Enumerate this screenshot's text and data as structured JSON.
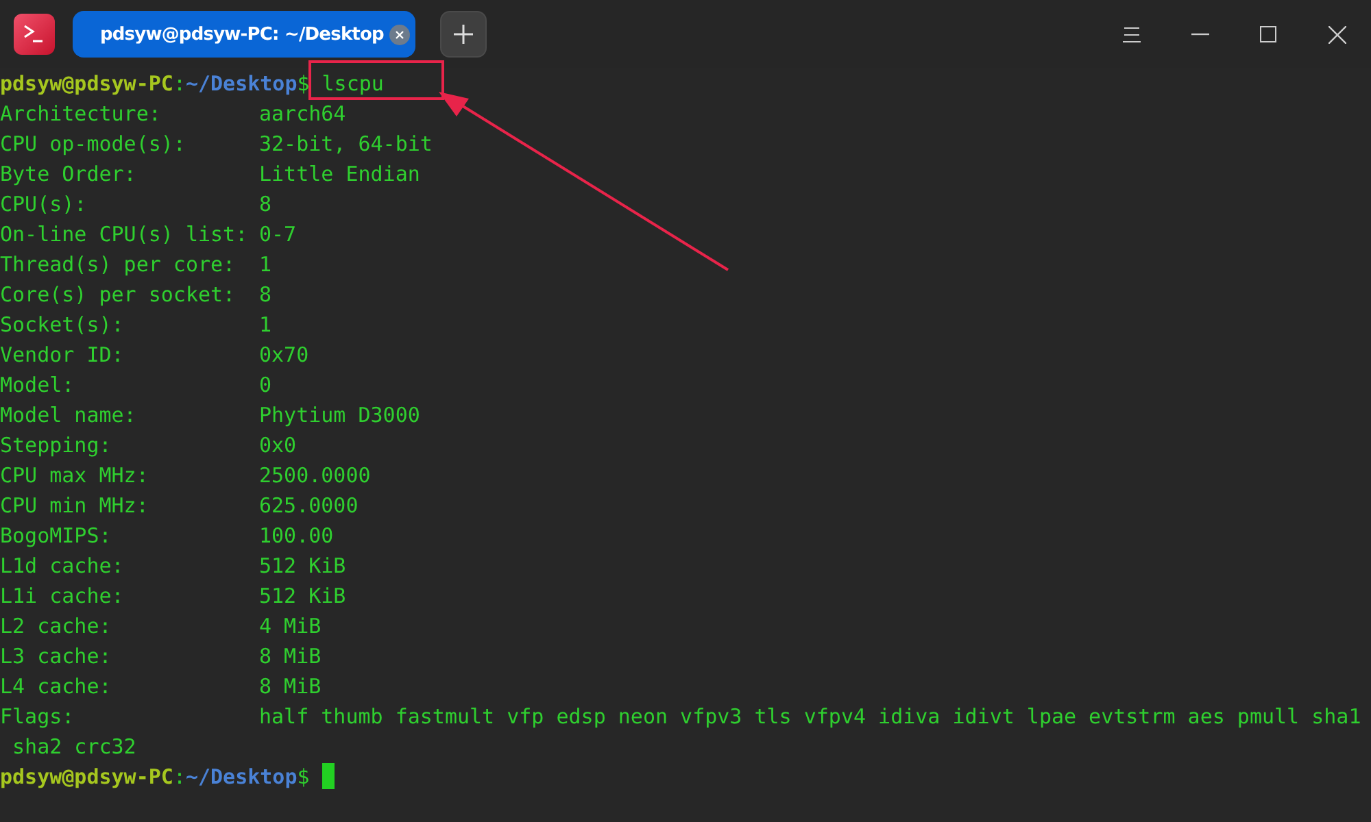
{
  "window": {
    "tab_title": "pdsyw@pdsyw-PC: ~/Desktop"
  },
  "terminal": {
    "lines": [
      {
        "kind": "prompt",
        "user": "pdsyw@pdsyw-PC",
        "sep": ":",
        "path": "~/Desktop",
        "sign": "$",
        "command": "lscpu"
      },
      {
        "kind": "field",
        "key": "Architecture:",
        "value": "aarch64"
      },
      {
        "kind": "field",
        "key": "CPU op-mode(s):",
        "value": "32-bit, 64-bit"
      },
      {
        "kind": "field",
        "key": "Byte Order:",
        "value": "Little Endian"
      },
      {
        "kind": "field",
        "key": "CPU(s):",
        "value": "8"
      },
      {
        "kind": "field",
        "key": "On-line CPU(s) list:",
        "value": "0-7"
      },
      {
        "kind": "field",
        "key": "Thread(s) per core:",
        "value": "1"
      },
      {
        "kind": "field",
        "key": "Core(s) per socket:",
        "value": "8"
      },
      {
        "kind": "field",
        "key": "Socket(s):",
        "value": "1"
      },
      {
        "kind": "field",
        "key": "Vendor ID:",
        "value": "0x70"
      },
      {
        "kind": "field",
        "key": "Model:",
        "value": "0"
      },
      {
        "kind": "field",
        "key": "Model name:",
        "value": "Phytium D3000"
      },
      {
        "kind": "field",
        "key": "Stepping:",
        "value": "0x0"
      },
      {
        "kind": "field",
        "key": "CPU max MHz:",
        "value": "2500.0000"
      },
      {
        "kind": "field",
        "key": "CPU min MHz:",
        "value": "625.0000"
      },
      {
        "kind": "field",
        "key": "BogoMIPS:",
        "value": "100.00"
      },
      {
        "kind": "field",
        "key": "L1d cache:",
        "value": "512 KiB"
      },
      {
        "kind": "field",
        "key": "L1i cache:",
        "value": "512 KiB"
      },
      {
        "kind": "field",
        "key": "L2 cache:",
        "value": "4 MiB"
      },
      {
        "kind": "field",
        "key": "L3 cache:",
        "value": "8 MiB"
      },
      {
        "kind": "field",
        "key": "L4 cache:",
        "value": "8 MiB"
      },
      {
        "kind": "field",
        "key": "Flags:",
        "value": "half thumb fastmult vfp edsp neon vfpv3 tls vfpv4 idiva idivt lpae evtstrm aes pmull sha1"
      },
      {
        "kind": "wrap",
        "text": " sha2 crc32"
      },
      {
        "kind": "prompt",
        "user": "pdsyw@pdsyw-PC",
        "sep": ":",
        "path": "~/Desktop",
        "sign": "$",
        "cursor": true
      }
    ]
  }
}
